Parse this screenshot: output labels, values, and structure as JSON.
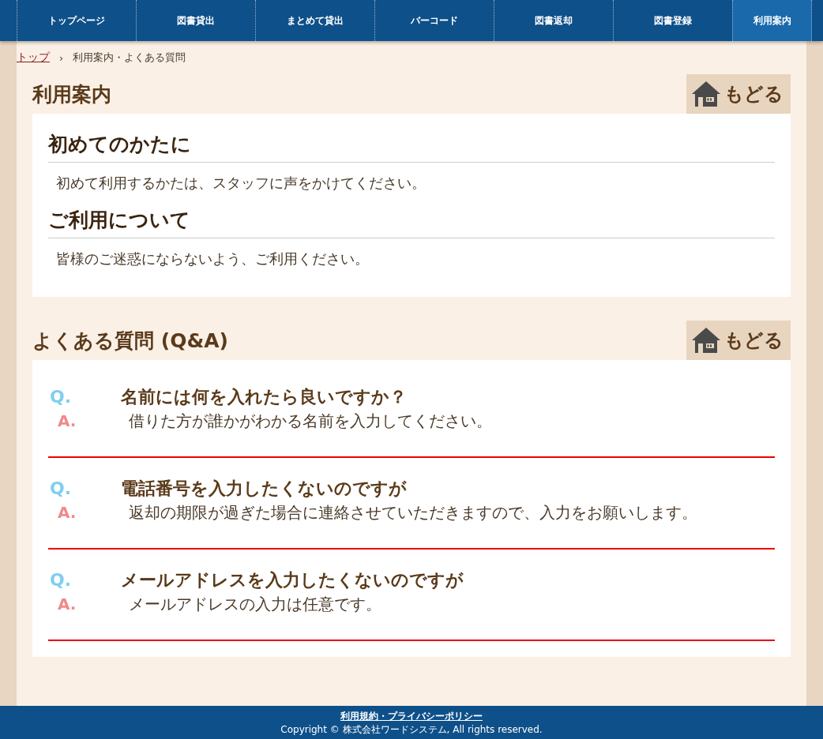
{
  "nav": [
    {
      "label": "トップページ",
      "selected": false
    },
    {
      "label": "図書貸出",
      "selected": false
    },
    {
      "label": "まとめて貸出",
      "selected": false
    },
    {
      "label": "バーコード",
      "selected": false
    },
    {
      "label": "図書返却",
      "selected": false
    },
    {
      "label": "図書登録",
      "selected": false
    },
    {
      "label": "利用案内",
      "selected": true
    }
  ],
  "breadcrumb": {
    "link": "トップ",
    "separator": "›",
    "current": "利用案内・よくある質問"
  },
  "sections": [
    {
      "kind": "guide",
      "title": "利用案内",
      "back_label": "もどる",
      "blocks": [
        {
          "heading": "初めてのかたに",
          "text": "初めて利用するかたは、スタッフに声をかけてください。"
        },
        {
          "heading": "ご利用について",
          "text": "皆様のご迷惑にならないよう、ご利用ください。"
        }
      ]
    },
    {
      "kind": "qa",
      "title": "よくある質問 (Q&A)",
      "back_label": "もどる",
      "items": [
        {
          "q_mark": "Q.",
          "question": "名前には何を入れたら良いですか？",
          "a_mark": "A.",
          "answer": "借りた方が誰かがわかる名前を入力してください。"
        },
        {
          "q_mark": "Q.",
          "question": "電話番号を入力したくないのですが",
          "a_mark": "A.",
          "answer": "返却の期限が過ぎた場合に連絡させていただきますので、入力をお願いします。"
        },
        {
          "q_mark": "Q.",
          "question": "メールアドレスを入力したくないのですが",
          "a_mark": "A.",
          "answer": "メールアドレスの入力は任意です。"
        }
      ]
    }
  ],
  "footer": {
    "link": "利用規約・プライバシーポリシー",
    "copyright": "Copyright © 株式会社ワードシステム, All rights reserved."
  }
}
